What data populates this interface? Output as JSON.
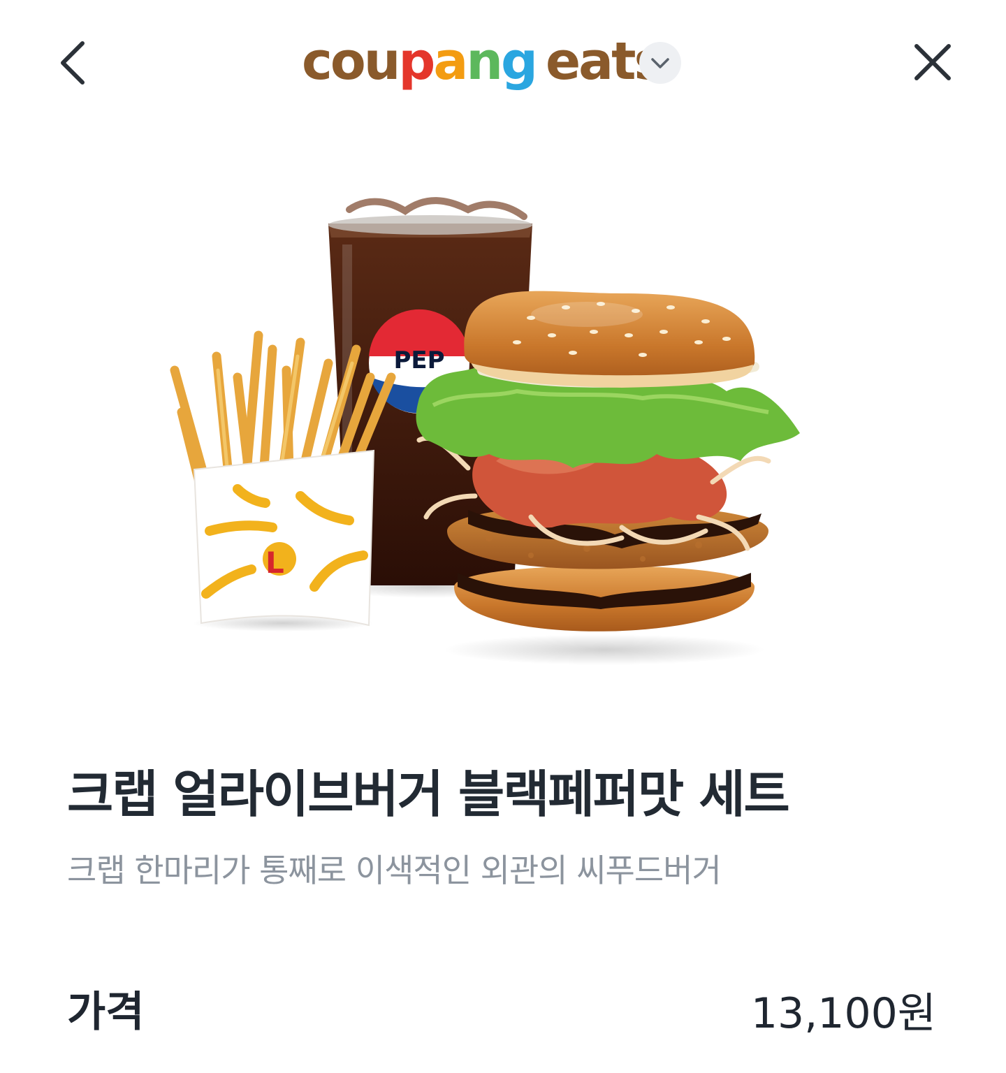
{
  "header": {
    "logo_parts": [
      {
        "text": "cou",
        "color": "#8a5a2b"
      },
      {
        "text": "p",
        "color": "#e4362b"
      },
      {
        "text": "a",
        "color": "#f39c12"
      },
      {
        "text": "n",
        "color": "#5cb85c"
      },
      {
        "text": "g",
        "color": "#2aa6e0"
      },
      {
        "text": "eats",
        "color": "#8a5a2b"
      }
    ],
    "back_icon": "chevron-left-icon",
    "close_icon": "close-icon",
    "dropdown_icon": "chevron-down-icon"
  },
  "product": {
    "image_items": [
      "fries",
      "pepsi-cola-drink",
      "crab-burger"
    ],
    "drink_brand_partial": "PEP",
    "fries_logo": "L",
    "title": "크랩 얼라이브버거 블랙페퍼맛 세트",
    "description": "크랩 한마리가 통째로 이색적인 외관의 씨푸드버거",
    "price_label": "가격",
    "price_value": "13,100원"
  },
  "colors": {
    "title": "#222a33",
    "subtitle": "#8c949e",
    "dropdown_bg": "#eef0f3"
  }
}
